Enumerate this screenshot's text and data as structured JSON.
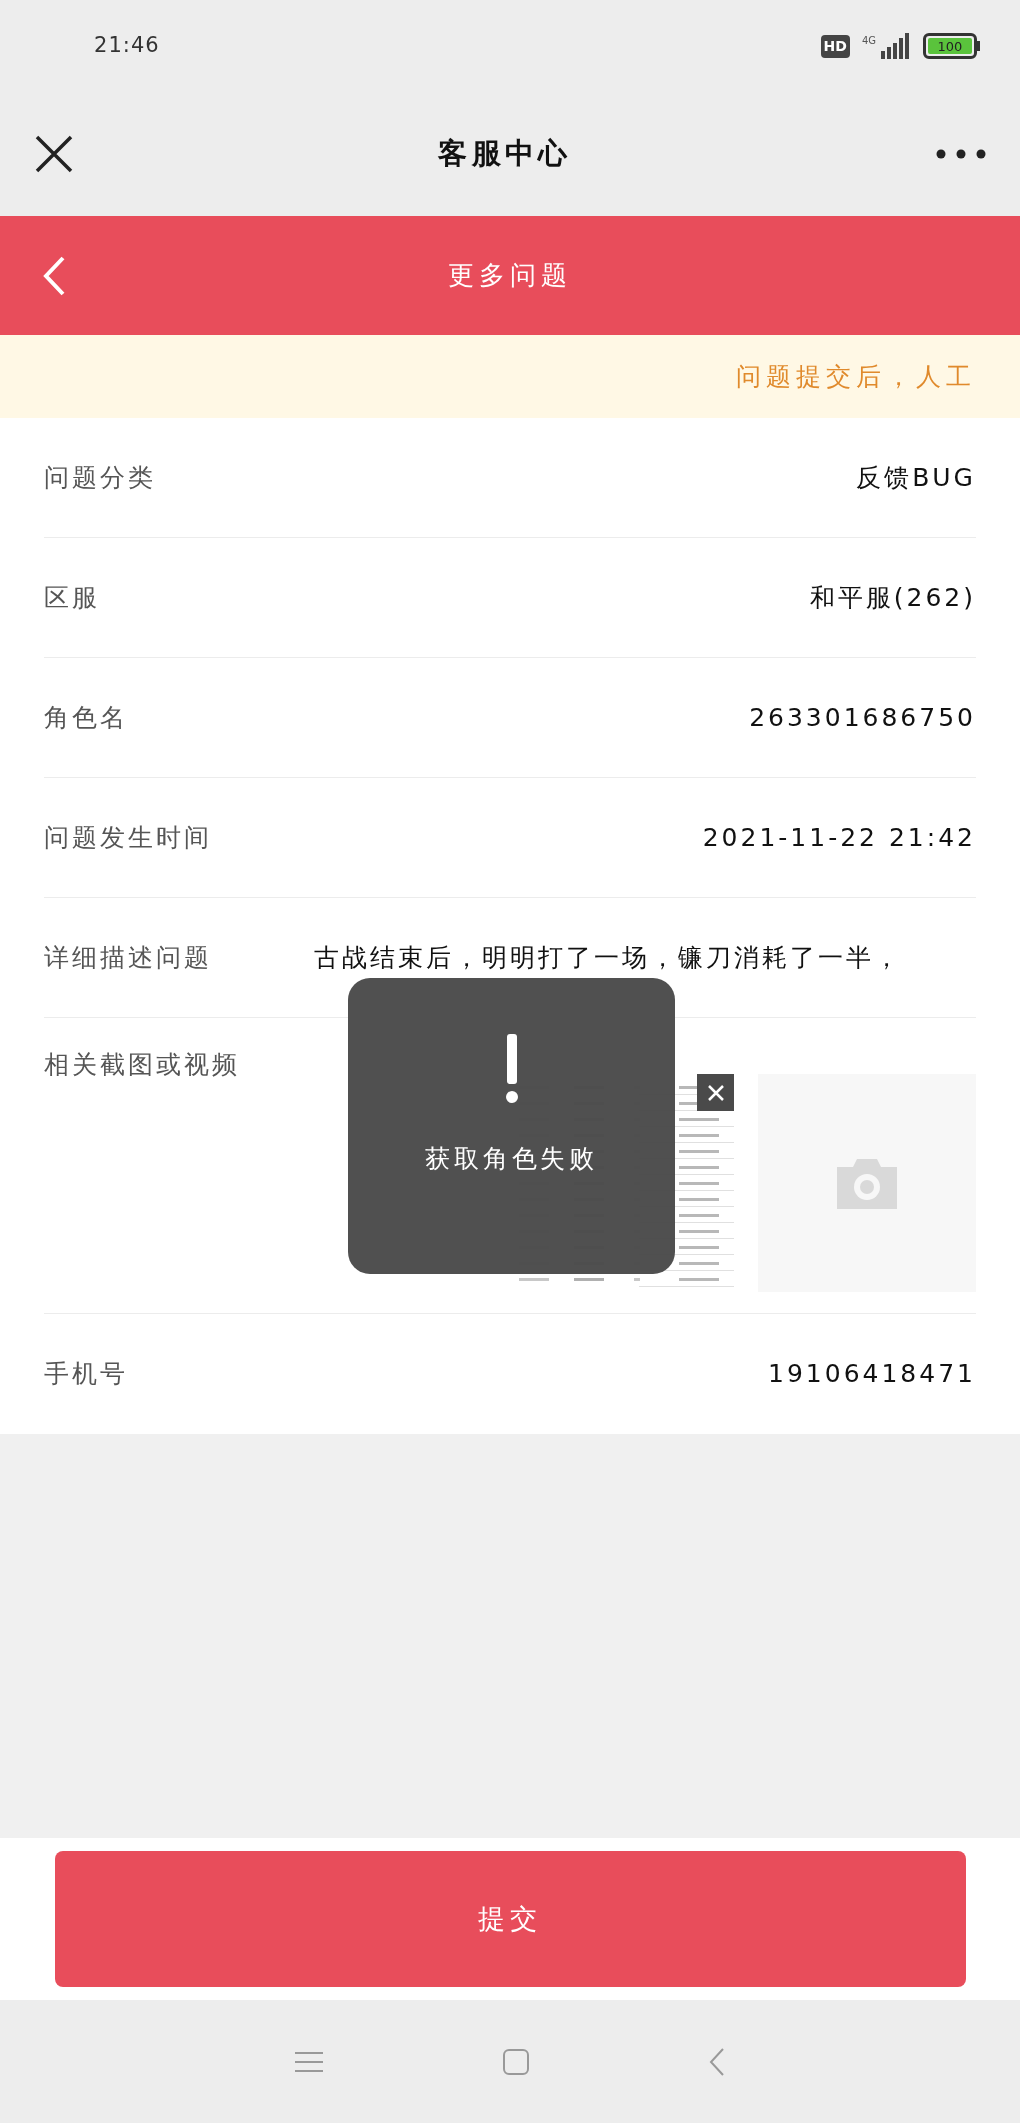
{
  "status_bar": {
    "time": "21:46",
    "hd": "HD",
    "network": "4G",
    "battery": "100"
  },
  "nav": {
    "title": "客服中心"
  },
  "header": {
    "title": "更多问题"
  },
  "notice": "问题提交后，人工",
  "fields": [
    {
      "label": "问题分类",
      "value": "反馈BUG",
      "kind": "text"
    },
    {
      "label": "区服",
      "value": "和平服(262)",
      "kind": "text"
    },
    {
      "label": "角色名",
      "value": "263301686750",
      "kind": "text"
    },
    {
      "label": "问题发生时间",
      "value": "2021-11-22 21:42",
      "kind": "text"
    },
    {
      "label": "详细描述问题",
      "value": "古战结束后，明明打了一场，镰刀消耗了一半，",
      "kind": "description"
    }
  ],
  "attachments": {
    "label": "相关截图或视频",
    "items": [
      {
        "kind": "picture"
      },
      {
        "kind": "add"
      }
    ]
  },
  "phone": {
    "label": "手机号",
    "value": "19106418471"
  },
  "toast": {
    "text": "获取角色失败"
  },
  "submit": "提交"
}
